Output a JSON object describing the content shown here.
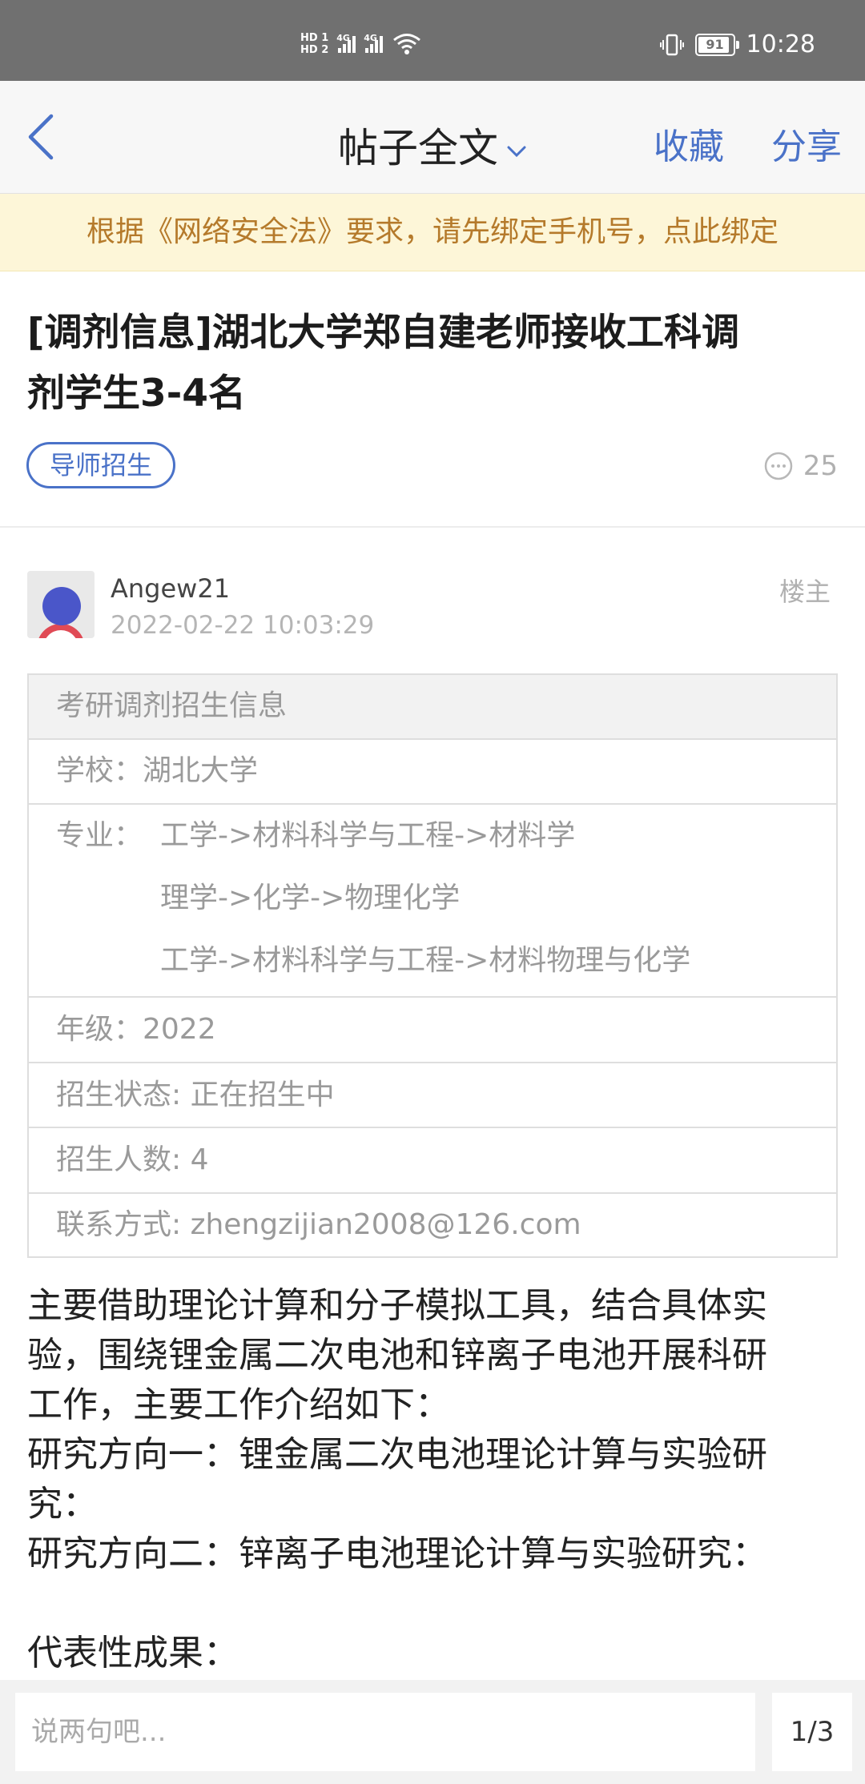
{
  "status_bar": {
    "hd1": "HD 1",
    "hd2": "HD 2",
    "net1": "4G",
    "net2": "4G",
    "battery": "91",
    "time": "10:28"
  },
  "nav": {
    "title": "帖子全文",
    "favorite": "收藏",
    "share": "分享"
  },
  "notice": "根据《网络安全法》要求，请先绑定手机号，点此绑定",
  "post": {
    "title_line1": "[调剂信息]湖北大学郑自建老师接收工科调",
    "title_line2": "剂学生3-4名",
    "tag": "导师招生",
    "comment_count": "25",
    "author": "Angew21",
    "time": "2022-02-22 10:03:29",
    "role": "楼主"
  },
  "info_table": {
    "header": "考研调剂招生信息",
    "school": "学校：湖北大学",
    "major_label": "专业：",
    "majors": [
      "工学->材料科学与工程->材料学",
      "理学->化学->物理化学",
      "工学->材料科学与工程->材料物理与化学"
    ],
    "grade": "年级：2022",
    "status": "招生状态: 正在招生中",
    "count": "招生人数: 4",
    "contact": "联系方式: zhengzijian2008@126.com"
  },
  "body": {
    "line1": "主要借助理论计算和分子模拟工具，结合具体实",
    "line2": "验，围绕锂金属二次电池和锌离子电池开展科研",
    "line3": "工作，主要工作介绍如下：",
    "line4": "研究方向一：锂金属二次电池理论计算与实验研",
    "line5": "究：",
    "line6": "研究方向二：锌离子电池理论计算与实验研究：",
    "line7": "",
    "line8": "代表性成果："
  },
  "bottom": {
    "placeholder": "说两句吧...",
    "page": "1/3"
  },
  "colors": {
    "accent": "#4a72c8",
    "notice_bg": "#fdf6d8",
    "notice_text": "#b57a2b"
  }
}
